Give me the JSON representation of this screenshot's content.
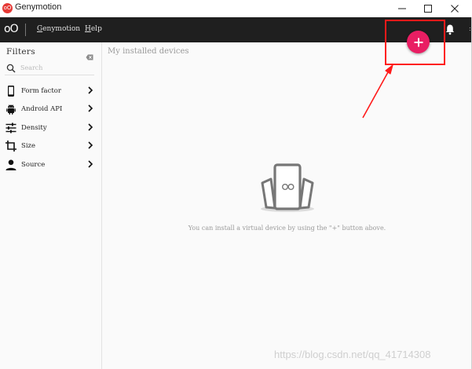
{
  "window": {
    "title": "Genymotion",
    "logo_text": "oO"
  },
  "toolbar": {
    "logo_text": "oO",
    "menus": [
      {
        "label": "Genymotion",
        "mnemonic": "G",
        "rest": "enymotion"
      },
      {
        "label": "Help",
        "mnemonic": "H",
        "rest": "elp"
      }
    ]
  },
  "sidebar": {
    "title": "Filters",
    "search": {
      "placeholder": "Search",
      "value": ""
    },
    "items": [
      {
        "label": "Form factor",
        "icon": "phone-icon"
      },
      {
        "label": "Android API",
        "icon": "android-icon"
      },
      {
        "label": "Density",
        "icon": "sliders-icon"
      },
      {
        "label": "Size",
        "icon": "crop-icon"
      },
      {
        "label": "Source",
        "icon": "person-icon"
      }
    ]
  },
  "main": {
    "title": "My installed devices",
    "empty_message": "You can install a virtual device by using the \"+\" button above."
  },
  "watermark": "https://blog.csdn.net/qq_41714308",
  "colors": {
    "accent": "#e91e63",
    "toolbar_bg": "#1f1f1f",
    "annotation": "#ff1a1a"
  }
}
